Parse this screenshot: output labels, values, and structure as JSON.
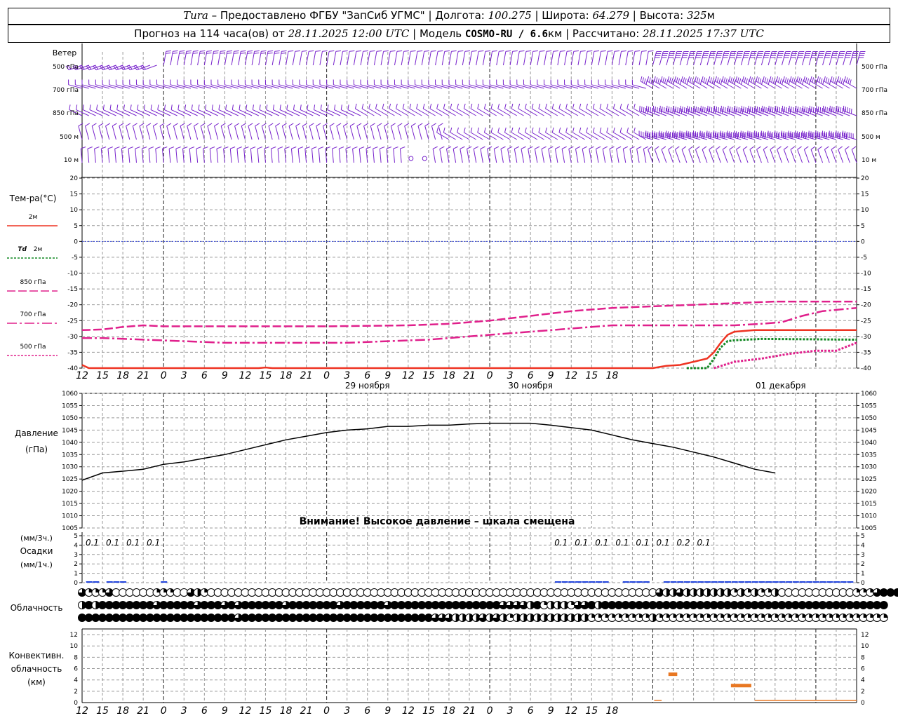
{
  "header": {
    "station": "Tura",
    "provider": "– Предоставлено ФГБУ \"ЗапСиб УГМС\"",
    "lon_label": "| Долгота:",
    "lon_value": "100.275",
    "lat_label": "| Широта:",
    "lat_value": "64.279",
    "alt_label": "| Высота:",
    "alt_value": "325",
    "alt_unit": "м",
    "forecast_label": "Прогноз на 114 часа(ов) от",
    "forecast_start": "28.11.2025 12:00 UTC",
    "model_label": "| Модель",
    "model_name": "COSMO-RU / 6.6",
    "model_unit": "км",
    "calc_label": "| Рассчитано:",
    "calc_time": "28.11.2025 17:37 UTC"
  },
  "labels": {
    "wind": "Ветер",
    "wind_levels": [
      "500 гПа",
      "700 гПа",
      "850 гПа",
      "500 м",
      "10 м"
    ],
    "temp_title": "Тем-ра(°С)",
    "legend_2m": "2м",
    "legend_td": "Td",
    "legend_td2": "2м",
    "legend_850": "850 гПа",
    "legend_700": "700 гПа",
    "legend_500": "500 гПа",
    "pressure_title": "Давление",
    "pressure_unit": "(гПа)",
    "pressure_warning": "Внимание! Высокое давление – шкала смещена",
    "precip_unit3": "(мм/3ч.)",
    "precip_title": "Осадки",
    "precip_unit1": "(мм/1ч.)",
    "cloud_title": "Облачность",
    "conv_title1": "Конвективн.",
    "conv_title2": "облачность",
    "conv_unit": "(км)"
  },
  "chart_data": {
    "type": "line",
    "x_hours": [
      0,
      114
    ],
    "hour_ticks": [
      "12",
      "15",
      "18",
      "21",
      "0",
      "3",
      "6",
      "9",
      "12",
      "15",
      "18",
      "21",
      "0",
      "3",
      "6",
      "9",
      "12",
      "15",
      "18",
      "21",
      "0",
      "3",
      "6",
      "9",
      "12",
      "15",
      "18"
    ],
    "date_labels": [
      {
        "hour": 42,
        "text": "29 ноября"
      },
      {
        "hour": 66,
        "text": "30 ноября"
      },
      {
        "hour": 102,
        "text": "01 декабря"
      }
    ],
    "temperature": {
      "ylim": [
        -40,
        20
      ],
      "ticks": [
        "20",
        "15",
        "10",
        "5",
        "0",
        "-5",
        "-10",
        "-15",
        "-20",
        "-25",
        "-30",
        "-35",
        "-40"
      ],
      "series": [
        {
          "name": "2м",
          "color": "#ee3322",
          "style": "solid",
          "points": [
            [
              0,
              -39
            ],
            [
              1,
              -40
            ],
            [
              26,
              -40
            ],
            [
              27,
              -39.8
            ],
            [
              28,
              -40
            ],
            [
              84,
              -40
            ],
            [
              86,
              -39.3
            ],
            [
              88,
              -39
            ],
            [
              90,
              -38
            ],
            [
              92,
              -37
            ],
            [
              93,
              -35
            ],
            [
              94,
              -32
            ],
            [
              95,
              -29.5
            ],
            [
              96,
              -28.5
            ],
            [
              99,
              -28
            ],
            [
              114,
              -28
            ]
          ]
        },
        {
          "name": "Td 2м",
          "color": "#118822",
          "style": "dot",
          "points": [
            [
              89,
              -40
            ],
            [
              92,
              -40
            ],
            [
              93,
              -37
            ],
            [
              94,
              -33.5
            ],
            [
              95,
              -31.5
            ],
            [
              96,
              -31.2
            ],
            [
              100,
              -30.8
            ],
            [
              114,
              -31
            ]
          ]
        },
        {
          "name": "850 гПа",
          "color": "#e0208c",
          "style": "dash",
          "points": [
            [
              0,
              -28
            ],
            [
              3,
              -27.8
            ],
            [
              6,
              -27
            ],
            [
              9,
              -26.5
            ],
            [
              12,
              -26.8
            ],
            [
              24,
              -26.8
            ],
            [
              36,
              -26.8
            ],
            [
              48,
              -26.5
            ],
            [
              54,
              -26
            ],
            [
              60,
              -25
            ],
            [
              66,
              -23.5
            ],
            [
              72,
              -22
            ],
            [
              78,
              -21
            ],
            [
              84,
              -20.5
            ],
            [
              90,
              -20
            ],
            [
              96,
              -19.5
            ],
            [
              102,
              -19
            ],
            [
              108,
              -19
            ],
            [
              114,
              -19
            ]
          ]
        },
        {
          "name": "700 гПа",
          "color": "#e0208c",
          "style": "dashdot",
          "points": [
            [
              0,
              -30.5
            ],
            [
              3,
              -30.5
            ],
            [
              9,
              -31
            ],
            [
              15,
              -31.5
            ],
            [
              21,
              -32
            ],
            [
              27,
              -32
            ],
            [
              33,
              -32
            ],
            [
              39,
              -32
            ],
            [
              45,
              -31.5
            ],
            [
              51,
              -31
            ],
            [
              57,
              -30
            ],
            [
              63,
              -29
            ],
            [
              66,
              -28.5
            ],
            [
              72,
              -27.5
            ],
            [
              78,
              -26.5
            ],
            [
              84,
              -26.5
            ],
            [
              90,
              -26.5
            ],
            [
              96,
              -26.5
            ],
            [
              100,
              -26
            ],
            [
              103,
              -25.5
            ],
            [
              106,
              -23.5
            ],
            [
              109,
              -22
            ],
            [
              114,
              -21
            ]
          ]
        },
        {
          "name": "500 гПа",
          "color": "#e0208c",
          "style": "dot",
          "points": [
            [
              93,
              -40
            ],
            [
              96,
              -38
            ],
            [
              100,
              -37
            ],
            [
              104,
              -35.5
            ],
            [
              108,
              -34.5
            ],
            [
              111,
              -34.5
            ],
            [
              114,
              -32
            ]
          ]
        }
      ]
    },
    "pressure": {
      "ylim": [
        1005,
        1060
      ],
      "ticks": [
        "1060",
        "1055",
        "1050",
        "1045",
        "1040",
        "1035",
        "1030",
        "1025",
        "1020",
        "1015",
        "1010",
        "1005"
      ],
      "points": [
        [
          0,
          1024.5
        ],
        [
          3,
          1027.5
        ],
        [
          6,
          1028.2
        ],
        [
          9,
          1029
        ],
        [
          12,
          1031
        ],
        [
          15,
          1032
        ],
        [
          18,
          1033.5
        ],
        [
          21,
          1035
        ],
        [
          24,
          1037
        ],
        [
          27,
          1039
        ],
        [
          30,
          1041
        ],
        [
          33,
          1042.5
        ],
        [
          36,
          1044
        ],
        [
          39,
          1045
        ],
        [
          42,
          1045.5
        ],
        [
          45,
          1046.5
        ],
        [
          48,
          1046.5
        ],
        [
          51,
          1047
        ],
        [
          54,
          1047
        ],
        [
          57,
          1047.5
        ],
        [
          60,
          1047.8
        ],
        [
          63,
          1047.8
        ],
        [
          66,
          1047.8
        ],
        [
          69,
          1047
        ],
        [
          72,
          1046
        ],
        [
          75,
          1045
        ],
        [
          78,
          1043
        ],
        [
          81,
          1041
        ],
        [
          84,
          1039.5
        ],
        [
          87,
          1038
        ],
        [
          90,
          1036
        ],
        [
          93,
          1034
        ],
        [
          96,
          1031.5
        ],
        [
          99,
          1029
        ],
        [
          102,
          1027.5
        ]
      ]
    },
    "precip": {
      "ylim": [
        0,
        5
      ],
      "ticks": [
        "5",
        "4",
        "3",
        "2",
        "1",
        "0"
      ],
      "labels_3h": [
        {
          "hour": 1.5,
          "value": "0.1"
        },
        {
          "hour": 4.5,
          "value": "0.1"
        },
        {
          "hour": 7.5,
          "value": "0.1"
        },
        {
          "hour": 10.5,
          "value": "0.1"
        },
        {
          "hour": 70.5,
          "value": "0.1"
        },
        {
          "hour": 73.5,
          "value": "0.1"
        },
        {
          "hour": 76.5,
          "value": "0.1"
        },
        {
          "hour": 79.5,
          "value": "0.1"
        },
        {
          "hour": 82.5,
          "value": "0.1"
        },
        {
          "hour": 85.5,
          "value": "0.1"
        },
        {
          "hour": 88.5,
          "value": "0.2"
        },
        {
          "hour": 91.5,
          "value": "0.1"
        }
      ],
      "hourly_nonzero": [
        1,
        2,
        4,
        5,
        6,
        12,
        70,
        71,
        72,
        73,
        74,
        75,
        76,
        77,
        80,
        81,
        82,
        83,
        86,
        87,
        88,
        89,
        90,
        91,
        92,
        93,
        94,
        95,
        96,
        97,
        98,
        99,
        100,
        101,
        102,
        103,
        104,
        105,
        106,
        107,
        108,
        109,
        110,
        111,
        112,
        113
      ]
    },
    "cloudiness": {
      "rows": [
        "high",
        "middle",
        "low"
      ],
      "levels_by_row": [
        "31113000000111003210000000000000000000000000000000000000000000000000000000000000000003223222222212121120000000000011134444",
        "24244444444344444344434344444434444444344444434444444444444444333324122213342444444444444444444444444444444444444444444",
        "44444444444444444444444344444444444444444444444444443332222323212222222222211111111121111111111111111111111111111111111"
      ]
    },
    "convective": {
      "ylim": [
        0,
        13
      ],
      "ticks": [
        "12",
        "10",
        "8",
        "6",
        "4",
        "2",
        "0"
      ],
      "bars": [
        {
          "from": 84.2,
          "to": 85.3,
          "value": 0.4,
          "color": "#e87722"
        },
        {
          "from": 86.3,
          "to": 87.6,
          "value": 5.0,
          "color": "#e87722"
        },
        {
          "from": 95.5,
          "to": 98.5,
          "value": 3.0,
          "color": "#e87722"
        },
        {
          "from": 99.0,
          "to": 114,
          "value": 0.4,
          "color": "#e87722"
        }
      ]
    }
  },
  "colors": {
    "wind_barb": "#7722cc",
    "grid": "#999999",
    "zero_line": "#3344dd",
    "precip_bar": "#2244dd",
    "pressure_line": "#000000"
  }
}
